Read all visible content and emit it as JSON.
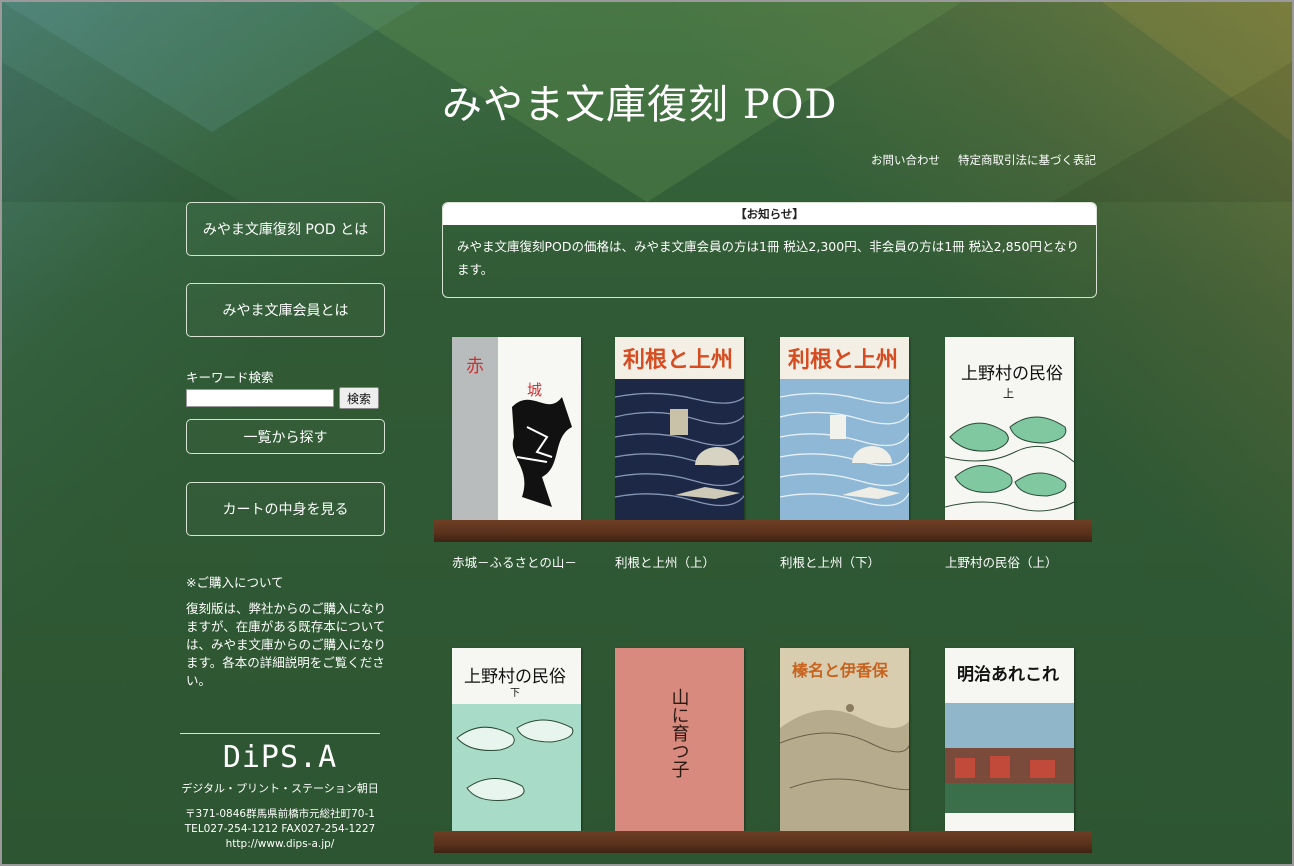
{
  "header": {
    "site_title": "みやま文庫復刻 POD",
    "links": [
      "お問い合わせ",
      "特定商取引法に基づく表記"
    ]
  },
  "sidebar": {
    "about_pod": "みやま文庫復刻 POD とは",
    "about_member": "みやま文庫会員とは",
    "keyword_label": "キーワード検索",
    "search_button": "検索",
    "search_value": "",
    "list_button": "一覧から探す",
    "cart_button": "カートの中身を見る",
    "purchase_title": "※ご購入について",
    "purchase_text": "復刻版は、弊社からのご購入になりますが、在庫がある既存本については、みやま文庫からのご購入になります。各本の詳細説明をご覧ください。"
  },
  "footer": {
    "logo": "DiPS.A",
    "logo_sub": "デジタル・プリント・ステーション朝日",
    "address": "〒371-0846群馬県前橋市元総社町70-1",
    "tel": "TEL027-254-1212 FAX027-254-1227",
    "url": "http://www.dips-a.jp/"
  },
  "notice": {
    "heading": "【お知らせ】",
    "body": "みやま文庫復刻PODの価格は、みやま文庫会員の方は1冊 税込2,300円、非会員の方は1冊 税込2,850円となります。"
  },
  "books": [
    {
      "title": "赤城－ふるさとの山－",
      "cover_text": "赤 城"
    },
    {
      "title": "利根と上州（上）",
      "cover_text": "利根と上州"
    },
    {
      "title": "利根と上州（下）",
      "cover_text": "利根と上州"
    },
    {
      "title": "上野村の民俗（上）",
      "cover_text": "上野村の民俗"
    },
    {
      "title": "",
      "cover_text": "上野村の民俗"
    },
    {
      "title": "",
      "cover_text": "山に育つ子"
    },
    {
      "title": "",
      "cover_text": "榛名と伊香保"
    },
    {
      "title": "",
      "cover_text": "明治あれこれ"
    }
  ],
  "colors": {
    "background": "#2f5a34",
    "shelf": "#5a321c",
    "notice_border": "#d8e2d4"
  }
}
